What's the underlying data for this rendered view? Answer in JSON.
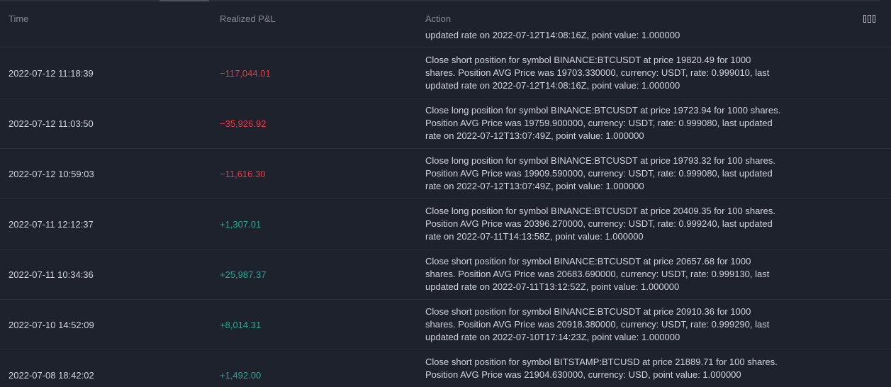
{
  "header": {
    "time": "Time",
    "pnl": "Realized P&L",
    "action": "Action",
    "columns_icon": "columns-settings-icon"
  },
  "partial_row": {
    "action": "updated rate on 2022-07-12T14:08:16Z, point value: 1.000000"
  },
  "rows": [
    {
      "time": "2022-07-12 11:18:39",
      "pnl": "−117,044.01",
      "sign": "neg",
      "action": "Close short position for symbol BINANCE:BTCUSDT at price 19820.49 for 1000\nshares. Position AVG Price was 19703.330000, currency: USDT, rate: 0.999010, last\nupdated rate on 2022-07-12T14:08:16Z, point value: 1.000000"
    },
    {
      "time": "2022-07-12 11:03:50",
      "pnl": "−35,926.92",
      "sign": "neg",
      "action": "Close long position for symbol BINANCE:BTCUSDT at price 19723.94 for 1000 shares.\nPosition AVG Price was 19759.900000, currency: USDT, rate: 0.999080, last updated\nrate on 2022-07-12T13:07:49Z, point value: 1.000000"
    },
    {
      "time": "2022-07-12 10:59:03",
      "pnl": "−11,616.30",
      "sign": "neg",
      "action": "Close long position for symbol BINANCE:BTCUSDT at price 19793.32 for 100 shares.\nPosition AVG Price was 19909.590000, currency: USDT, rate: 0.999080, last updated\nrate on 2022-07-12T13:07:49Z, point value: 1.000000"
    },
    {
      "time": "2022-07-11 12:12:37",
      "pnl": "+1,307.01",
      "sign": "pos",
      "action": "Close long position for symbol BINANCE:BTCUSDT at price 20409.35 for 100 shares.\nPosition AVG Price was 20396.270000, currency: USDT, rate: 0.999240, last updated\nrate on 2022-07-11T14:13:58Z, point value: 1.000000"
    },
    {
      "time": "2022-07-11 10:34:36",
      "pnl": "+25,987.37",
      "sign": "pos",
      "action": "Close short position for symbol BINANCE:BTCUSDT at price 20657.68 for 1000\nshares. Position AVG Price was 20683.690000, currency: USDT, rate: 0.999130, last\nupdated rate on 2022-07-11T13:12:52Z, point value: 1.000000"
    },
    {
      "time": "2022-07-10 14:52:09",
      "pnl": "+8,014.31",
      "sign": "pos",
      "action": "Close short position for symbol BINANCE:BTCUSDT at price 20910.36 for 1000\nshares. Position AVG Price was 20918.380000, currency: USDT, rate: 0.999290, last\nupdated rate on 2022-07-10T17:14:23Z, point value: 1.000000"
    },
    {
      "time": "2022-07-08 18:42:02",
      "pnl": "+1,492.00",
      "sign": "pos",
      "action": "Close short position for symbol BITSTAMP:BTCUSD at price 21889.71 for 100 shares.\nPosition AVG Price was 21904.630000, currency: USD, point value: 1.000000"
    }
  ],
  "colors": {
    "background": "#1e222d",
    "text": "#d1d4dc",
    "muted": "#868993",
    "negative": "#f23645",
    "positive": "#22ab94"
  }
}
